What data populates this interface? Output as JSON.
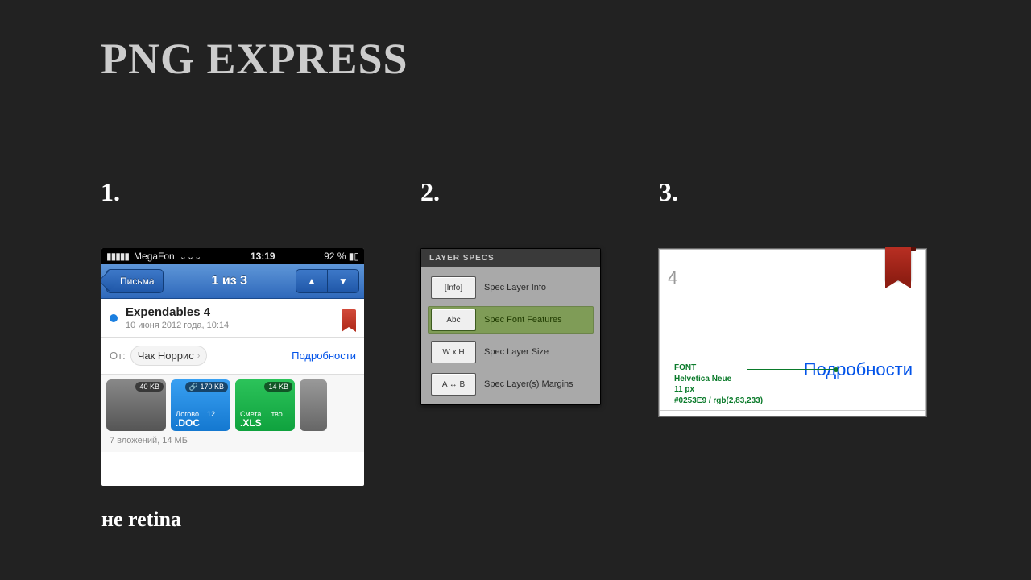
{
  "title": "PNG EXPRESS",
  "steps": {
    "one": "1.",
    "two": "2.",
    "three": "3."
  },
  "footnote": "не retina",
  "phone": {
    "status": {
      "carrier": "MegaFon",
      "time": "13:19",
      "battery": "92 %"
    },
    "nav": {
      "back": "Письма",
      "title": "1 из 3"
    },
    "message": {
      "subject": "Expendables 4",
      "date": "10 июня 2012 года, 10:14"
    },
    "from": {
      "label": "От:",
      "sender": "Чак Норрис",
      "details": "Подробности"
    },
    "attachments": [
      {
        "kind": "img",
        "size": "40 KB"
      },
      {
        "kind": "doc",
        "size": "170 KB",
        "name": "Догово....12",
        "ext": ".DOC"
      },
      {
        "kind": "xls",
        "size": "14 KB",
        "name": "Смета.....тво",
        "ext": ".XLS"
      }
    ],
    "attachments_meta": "7 вложений, 14 МБ"
  },
  "panel": {
    "header": "LAYER SPECS",
    "rows": [
      {
        "btn": "[Info]",
        "label": "Spec Layer Info"
      },
      {
        "btn": "Abc",
        "label": "Spec Font Features",
        "selected": true
      },
      {
        "btn": "W x H",
        "label": "Spec Layer Size"
      },
      {
        "btn": "A ↔ B",
        "label": "Spec Layer(s) Margins"
      }
    ]
  },
  "spec": {
    "corner_digit": "4",
    "sample_text": "Подробности",
    "meta": {
      "heading": "FONT",
      "family": "Helvetica Neue",
      "size": "11 px",
      "color": "#0253E9 / rgb(2,83,233)"
    }
  }
}
